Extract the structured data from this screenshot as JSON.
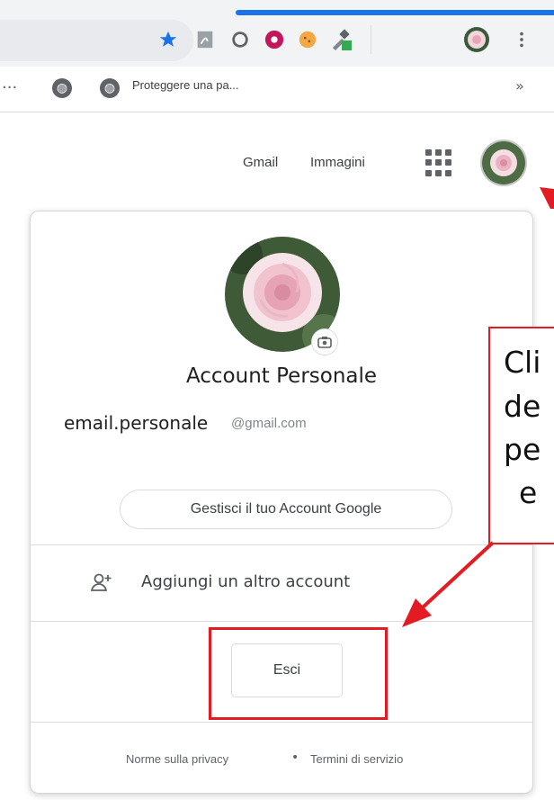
{
  "browser": {
    "bookmark_bar": {
      "ellipsis": "...",
      "bookmark_label": "Proteggere una pa...",
      "more_label": "»"
    },
    "toolbar_icons": [
      "star-icon",
      "pdf-extension-icon",
      "circle-extension-icon",
      "flower-extension-icon",
      "cookie-extension-icon",
      "eyedropper-extension-icon",
      "profile-avatar-icon",
      "kebab-menu-icon"
    ]
  },
  "header": {
    "gmail_label": "Gmail",
    "images_label": "Immagini"
  },
  "account": {
    "name": "Account Personale",
    "email_user": "email.personale",
    "email_domain": "@gmail.com",
    "manage_label": "Gestisci il tuo Account Google",
    "add_account_label": "Aggiungi un altro account",
    "logout_label": "Esci"
  },
  "footer": {
    "privacy_label": "Norme sulla privacy",
    "separator": "•",
    "terms_label": "Termini di servizio"
  },
  "annotation": {
    "callout_lines": [
      "Cli",
      "de",
      "pe",
      "e"
    ],
    "highlight_color": "#e31b23"
  },
  "colors": {
    "accent": "#1a73e8",
    "annotation_red": "#e31b23"
  }
}
